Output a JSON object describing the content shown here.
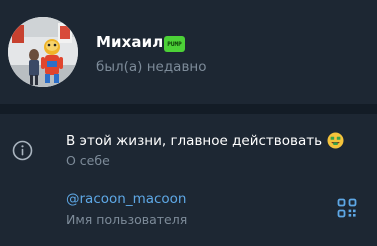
{
  "profile": {
    "name": "Михаил",
    "badge_text": "PUMP",
    "status": "был(а) недавно"
  },
  "info": {
    "bio": "В этой жизни, главное действовать",
    "bio_emoji": "money-mouth-face-icon",
    "bio_label": "О себе",
    "username": "@racoon_macoon",
    "username_label": "Имя пользователя"
  },
  "colors": {
    "background": "#18222d",
    "panel": "#1d2733",
    "text": "#ffffff",
    "secondary_text": "#7d8b99",
    "link": "#5ea8e6",
    "badge": "#4cd137"
  }
}
